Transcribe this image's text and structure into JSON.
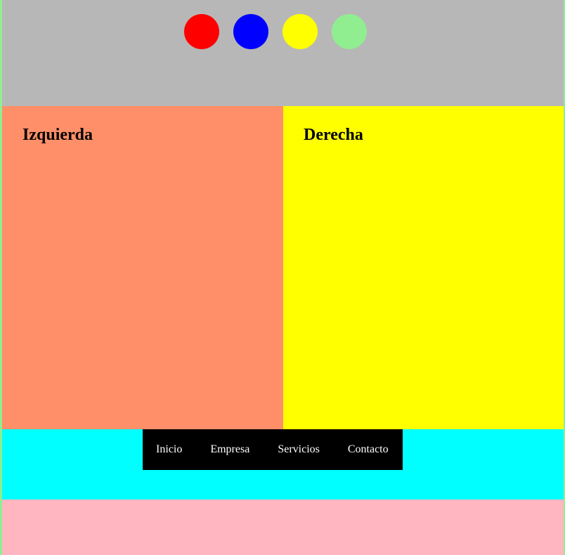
{
  "colors": {
    "page_border": "#90ee90",
    "header_bg": "#b7b7b7",
    "left_bg": "#ff8f68",
    "right_bg": "#ffff00",
    "nav_band_bg": "#00ffff",
    "nav_bg": "#000000",
    "footer_bg": "#ffb6c1"
  },
  "header": {
    "circles": [
      {
        "color": "#ff0000"
      },
      {
        "color": "#0000ff"
      },
      {
        "color": "#ffff00"
      },
      {
        "color": "#90ee90"
      }
    ]
  },
  "left": {
    "title": "Izquierda"
  },
  "right": {
    "title": "Derecha"
  },
  "nav": {
    "items": [
      {
        "label": "Inicio"
      },
      {
        "label": "Empresa"
      },
      {
        "label": "Servicios"
      },
      {
        "label": "Contacto"
      }
    ]
  }
}
